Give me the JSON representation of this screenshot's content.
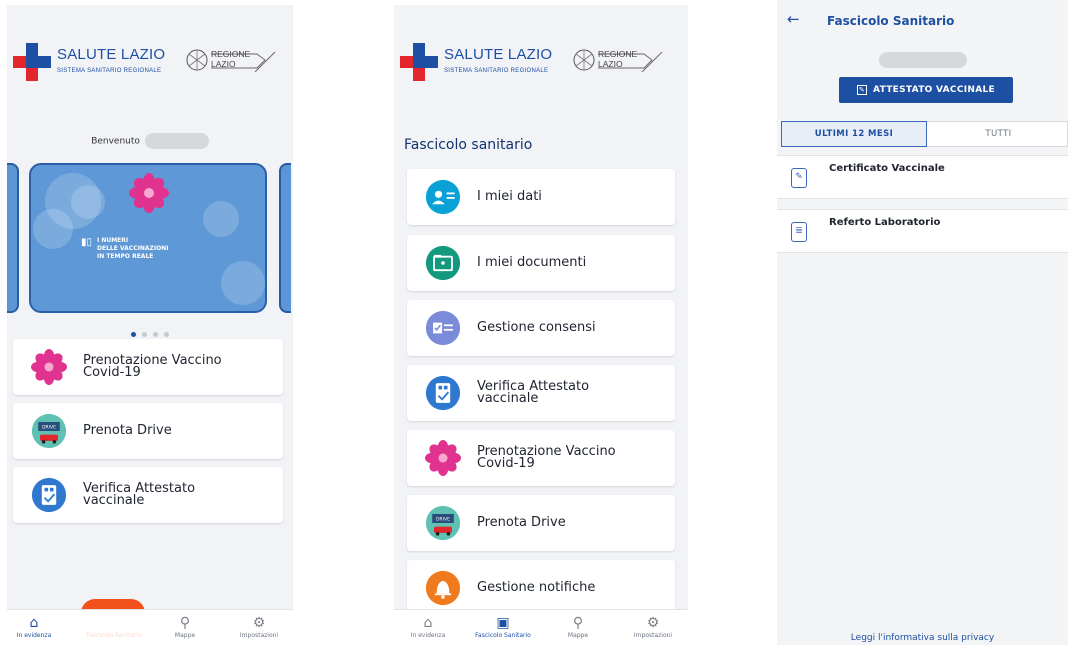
{
  "brand": {
    "title": "SALUTE LAZIO",
    "subtitle": "SISTEMA SANITARIO REGIONALE",
    "region_line1": "REGIONE",
    "region_line2": "LAZIO"
  },
  "home": {
    "welcome": "Benvenuto",
    "carousel_text": "I NUMERI\nDELLE VACCINAZIONI\nIN TEMPO REALE",
    "carousel_page": 1,
    "carousel_pages": 4,
    "cards": [
      {
        "label": "Prenotazione Vaccino Covid-19",
        "icon": "vaccine-flower-icon"
      },
      {
        "label": "Prenota Drive",
        "icon": "drive-icon"
      },
      {
        "label": "Verifica Attestato vaccinale",
        "icon": "qr-check-icon"
      }
    ]
  },
  "fascicolo": {
    "title": "Fascicolo sanitario",
    "items": [
      {
        "label": "I miei dati",
        "icon": "user-card-icon",
        "color": "#0aa2d6"
      },
      {
        "label": "I miei documenti",
        "icon": "folder-icon",
        "color": "#13997d"
      },
      {
        "label": "Gestione consensi",
        "icon": "consent-icon",
        "color": "#7a8bd9"
      },
      {
        "label": "Verifica Attestato vaccinale",
        "icon": "qr-check-icon",
        "color": "#2f78cf"
      },
      {
        "label": "Prenotazione Vaccino Covid-19",
        "icon": "vaccine-flower-icon",
        "color": "#e0338f"
      },
      {
        "label": "Prenota Drive",
        "icon": "drive-icon",
        "color": "#3fa29a"
      },
      {
        "label": "Gestione notifiche",
        "icon": "bell-icon",
        "color": "#f07a1e"
      }
    ]
  },
  "nav": {
    "items": [
      "In evidenza",
      "Fascicolo Sanitario",
      "Mappe",
      "Impostazioni"
    ]
  },
  "detail": {
    "title": "Fascicolo Sanitario",
    "button": "ATTESTATO VACCINALE",
    "tabs": [
      "ULTIMI 12 MESI",
      "TUTTI"
    ],
    "docs": [
      "Certificato Vaccinale",
      "Referto Laboratorio"
    ],
    "privacy": "Leggi l'informativa sulla privacy"
  },
  "colors": {
    "accent": "#1d4fa3",
    "brand_red": "#e3262b",
    "orange": "#f2511b"
  }
}
